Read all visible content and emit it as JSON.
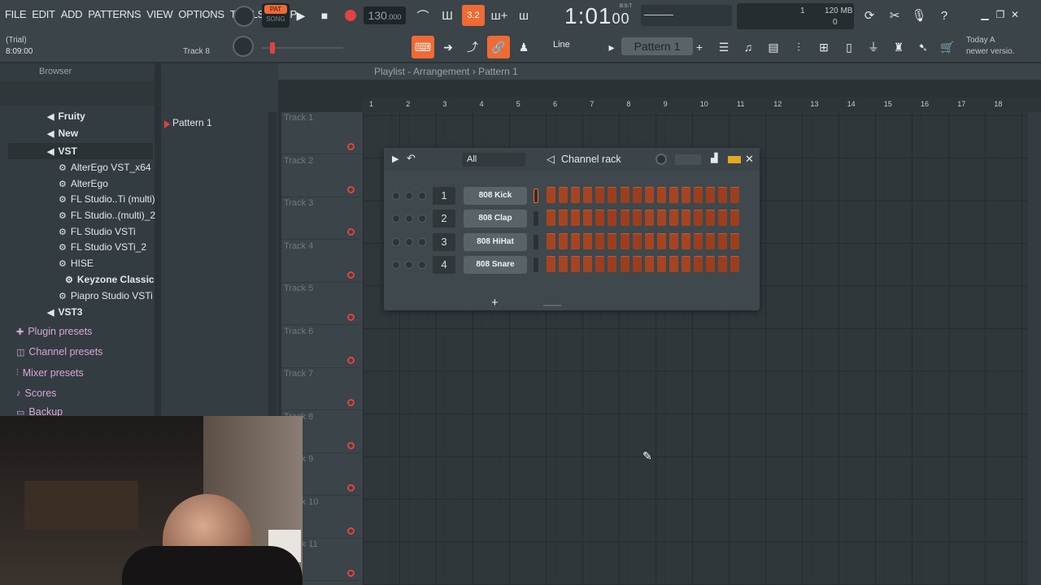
{
  "menu": [
    "FILE",
    "EDIT",
    "ADD",
    "PATTERNS",
    "VIEW",
    "OPTIONS",
    "TOOLS",
    "HELP"
  ],
  "transport": {
    "pat_label": "PAT",
    "song_label": "SONG",
    "tempo_main": "130",
    "tempo_frac": ".000",
    "time_main": "1:01",
    "time_sub": "00",
    "time_unit": "B:S:T",
    "snap_label": "3.2"
  },
  "status": {
    "trial": "(Trial)",
    "time": "8:09:00",
    "hint_track": "Track 8",
    "cpu_ram": "120 MB",
    "cpu_a": "1",
    "cpu_c": "0"
  },
  "toolbar2": {
    "snap_mode": "Line",
    "pattern": "Pattern 1",
    "news_1": "Today",
    "news_a": "A",
    "news_2": "newer versio."
  },
  "browser": {
    "title": "Browser",
    "items": [
      {
        "label": "Fruity",
        "kind": "folder"
      },
      {
        "label": "New",
        "kind": "folder"
      },
      {
        "label": "VST",
        "kind": "folder"
      },
      {
        "label": "AlterEgo VST_x64",
        "kind": "plugin"
      },
      {
        "label": "AlterEgo",
        "kind": "plugin"
      },
      {
        "label": "FL Studio..Ti (multi)",
        "kind": "plugin"
      },
      {
        "label": "FL Studio..(multi)_2",
        "kind": "plugin"
      },
      {
        "label": "FL Studio VSTi",
        "kind": "plugin"
      },
      {
        "label": "FL Studio VSTi_2",
        "kind": "plugin"
      },
      {
        "label": "HISE",
        "kind": "plugin"
      },
      {
        "label": "Keyzone Classic",
        "kind": "plugin"
      },
      {
        "label": "Piapro Studio VSTi",
        "kind": "plugin"
      },
      {
        "label": "VST3",
        "kind": "folder"
      }
    ],
    "categories": [
      "Plugin presets",
      "Channel presets",
      "Mixer presets",
      "Scores",
      "Backup"
    ]
  },
  "playlist": {
    "breadcrumb": "Playlist - Arrangement",
    "sep": "›",
    "current": "Pattern 1",
    "pattern_list": [
      "Pattern 1"
    ],
    "tracks": [
      "Track 1",
      "Track 2",
      "Track 3",
      "Track 4",
      "Track 5",
      "Track 6",
      "Track 7",
      "Track 8",
      "Track 9",
      "Track 10",
      "Track 11"
    ],
    "bars": [
      "1",
      "2",
      "3",
      "4",
      "5",
      "6",
      "7",
      "8",
      "9",
      "10",
      "11",
      "12",
      "13",
      "14",
      "15",
      "16",
      "17",
      "18"
    ]
  },
  "channel_rack": {
    "title": "Channel rack",
    "filter": "All",
    "channels": [
      {
        "num": "1",
        "name": "808 Kick"
      },
      {
        "num": "2",
        "name": "808 Clap"
      },
      {
        "num": "3",
        "name": "808 HiHat"
      },
      {
        "num": "4",
        "name": "808 Snare"
      }
    ],
    "add_label": "+"
  },
  "colors": {
    "accent": "#f06a34",
    "record": "#e2433a",
    "step": "#a64422"
  }
}
